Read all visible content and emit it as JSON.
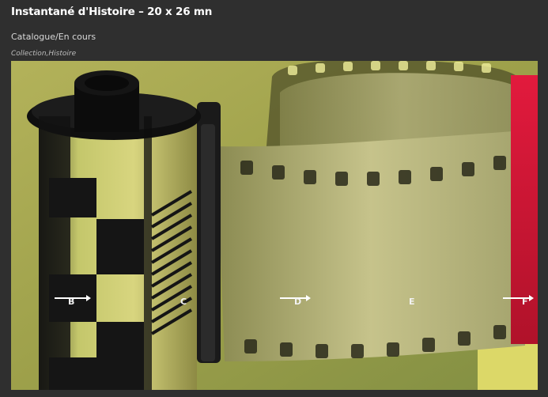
{
  "page": {
    "title": "Instantané d'Histoire – 20 x 26 mn",
    "breadcrumb": "Catalogue/En cours",
    "tags": "Collection,Histoire"
  },
  "video": {
    "markers": [
      {
        "label": "B",
        "has_arrow": true
      },
      {
        "label": "C",
        "has_arrow": false
      },
      {
        "label": "D",
        "has_arrow": true
      },
      {
        "label": "E",
        "has_arrow": false
      },
      {
        "label": "F",
        "has_arrow": true
      }
    ]
  },
  "colors": {
    "background": "#2f2f2f",
    "image_tint": "#a7a64c",
    "canister_dark": "#111111",
    "film_frame": "#1a1a1a",
    "red_edge": "#d7193d"
  }
}
